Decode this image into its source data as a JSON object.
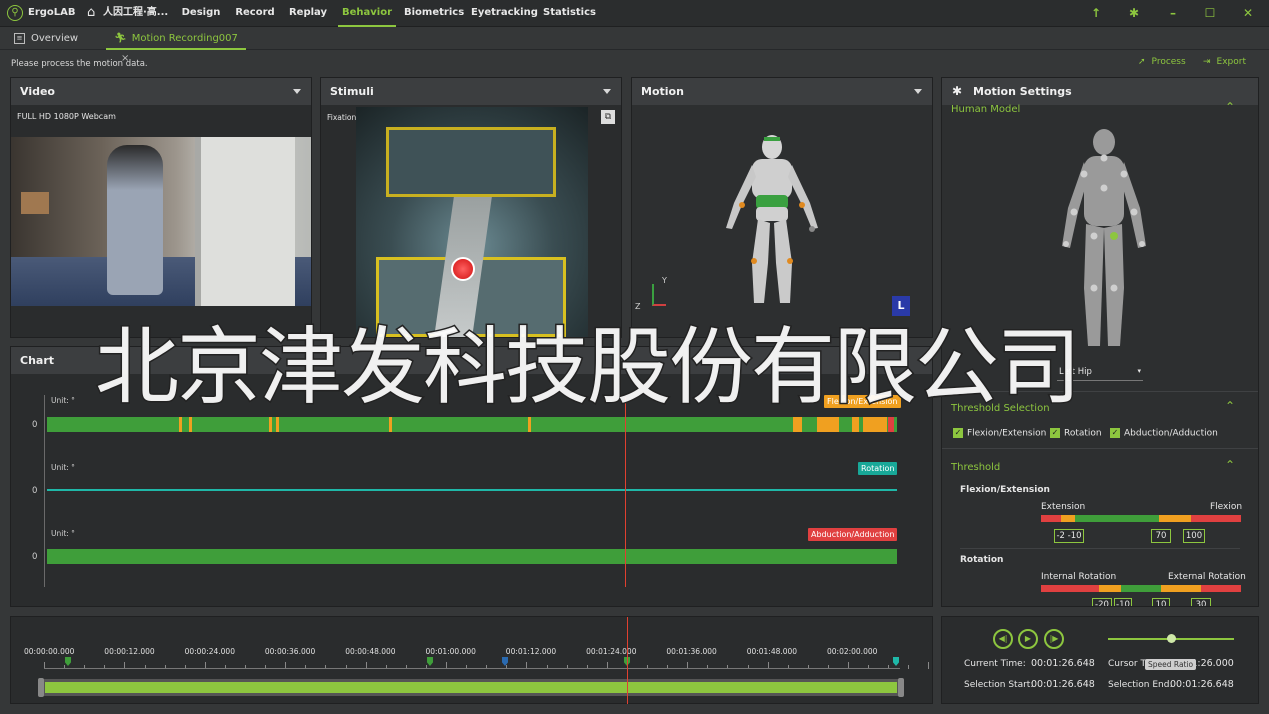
{
  "app": {
    "name": "ErgoLAB",
    "project": "人因工程·高..."
  },
  "menu": {
    "items": [
      {
        "label": "Design"
      },
      {
        "label": "Record"
      },
      {
        "label": "Replay"
      },
      {
        "label": "Behavior"
      },
      {
        "label": "Biometrics"
      },
      {
        "label": "Eyetracking"
      },
      {
        "label": "Statistics"
      }
    ],
    "active": "Behavior"
  },
  "tabs": [
    {
      "label": "Overview"
    },
    {
      "label": "Motion Recording007"
    }
  ],
  "status_message": "Please process the motion data.",
  "actions": {
    "process": "Process",
    "export": "Export"
  },
  "panels": {
    "video": {
      "title": "Video",
      "source": "FULL HD 1080P Webcam"
    },
    "stimuli": {
      "title": "Stimuli",
      "mode": "Fixation"
    },
    "motion": {
      "title": "Motion",
      "axis_labels": {
        "y": "Y",
        "z": "Z"
      },
      "badge": "L"
    },
    "chart": {
      "title": "Chart"
    }
  },
  "chart_data": {
    "type": "line",
    "series": [
      {
        "name": "Flexion/Extension",
        "unit": "Unit: °",
        "zero_label": "0",
        "color": "#f0a020"
      },
      {
        "name": "Rotation",
        "unit": "Unit: °",
        "zero_label": "0",
        "color": "#1fb8a8"
      },
      {
        "name": "Abduction/Adduction",
        "unit": "Unit: °",
        "zero_label": "0",
        "color": "#e04040"
      }
    ]
  },
  "timeline": {
    "ticks": [
      "00:00:00.000",
      "00:00:12.000",
      "00:00:24.000",
      "00:00:36.000",
      "00:00:48.000",
      "00:01:00.000",
      "00:01:12.000",
      "00:01:24.000",
      "00:01:36.000",
      "00:01:48.000",
      "00:02:00.000"
    ],
    "cursor_fraction": 0.686
  },
  "motion_settings": {
    "title": "Motion Settings",
    "human_model": {
      "title": "Human Model",
      "selected": "Left Hip"
    },
    "threshold_selection": {
      "title": "Threshold Selection",
      "options": [
        {
          "label": "Flexion/Extension",
          "checked": true
        },
        {
          "label": "Rotation",
          "checked": true
        },
        {
          "label": "Abduction/Adduction",
          "checked": true
        }
      ]
    },
    "threshold": {
      "title": "Threshold",
      "flexion": {
        "title": "Flexion/Extension",
        "left": "Extension",
        "right": "Flexion",
        "values": [
          "-2",
          "-10",
          "70",
          "100"
        ]
      },
      "rotation": {
        "title": "Rotation",
        "left": "Internal Rotation",
        "right": "External Rotation",
        "values": [
          "-20",
          "-10",
          "10",
          "30"
        ]
      }
    }
  },
  "playback": {
    "current_time_label": "Current Time:",
    "current_time": "00:01:26.648",
    "cursor_time_label": "Cursor Time:",
    "cursor_time": "00:01:26.000",
    "selection_start_label": "Selection Start:",
    "selection_start": "00:01:26.648",
    "selection_end_label": "Selection End:",
    "selection_end": "00:01:26.648",
    "speed_tooltip": "Speed Ratio",
    "speed_fraction": 0.5
  },
  "watermark": "北京津发科技股份有限公司",
  "colors": {
    "accent": "#8dc63f",
    "bar": "#3f9e3a",
    "orange": "#f0a020",
    "teal": "#1fb8a8",
    "red": "#e04040"
  }
}
